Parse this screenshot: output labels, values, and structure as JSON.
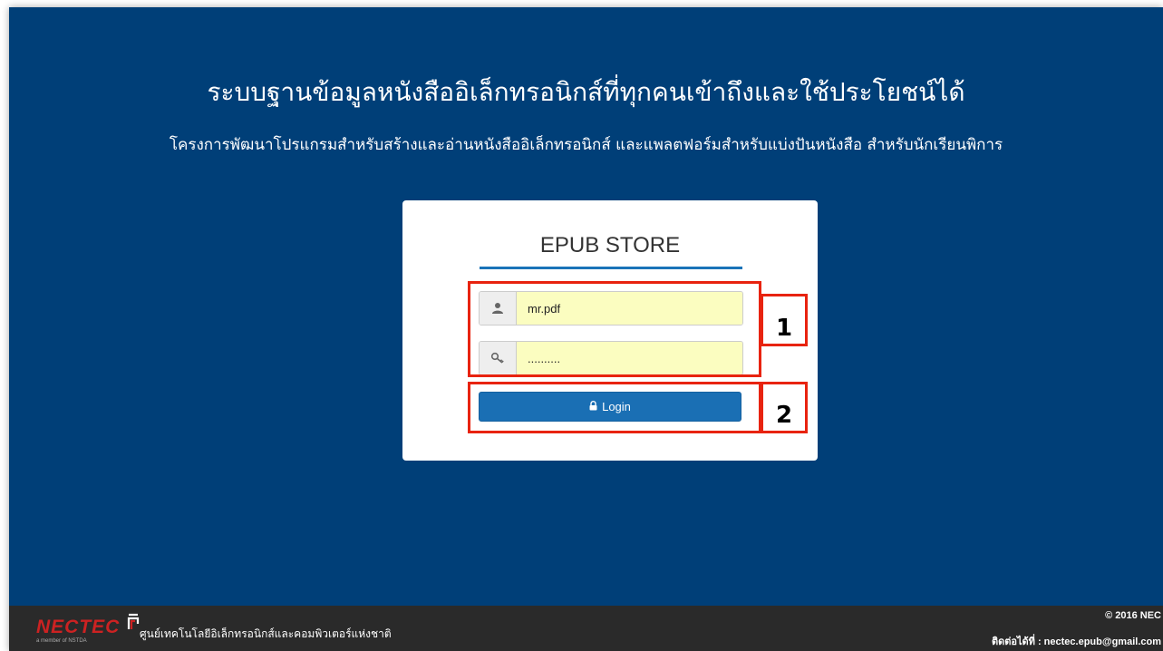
{
  "header": {
    "title": "ระบบฐานข้อมูลหนังสืออิเล็กทรอนิกส์ที่ทุกคนเข้าถึงและใช้ประโยชน์ได้",
    "subtitle": "โครงการพัฒนาโปรแกรมสำหรับสร้างและอ่านหนังสืออิเล็กทรอนิกส์ และแพลตฟอร์มสำหรับแบ่งปันหนังสือ สำหรับนักเรียนพิการ"
  },
  "login": {
    "title": "EPUB STORE",
    "username_value": "mr.pdf",
    "password_value": "..........",
    "button_label": "Login",
    "icons": {
      "user": "user-icon",
      "key": "key-icon",
      "lock": "lock-icon"
    }
  },
  "annotations": {
    "label_1": "1",
    "label_2": "2",
    "color": "#e8230f"
  },
  "footer": {
    "logo_text": "NECTEC",
    "logo_sub": "a member of NSTDA",
    "org_name": "ศูนย์เทคโนโลยีอิเล็กทรอนิกส์และคอมพิวเตอร์แห่งชาติ",
    "copyright": "© 2016 NEC",
    "contact": "ติดต่อได้ที่ : nectec.epub@gmail.com"
  },
  "colors": {
    "background": "#003f78",
    "accent": "#1a6fb4",
    "input_fill": "#fbfdc0",
    "footer": "#2a2a2a"
  }
}
